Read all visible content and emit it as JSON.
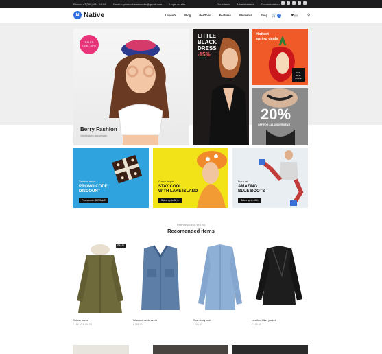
{
  "topbar": {
    "phone": "Phone: +3(266) 434-64-64",
    "email": "Email: dynamicthemeworks@gmail.com",
    "login": "Login on site",
    "links": [
      "Our clients",
      "Advertisement",
      "Documentation"
    ],
    "social_icons": [
      "facebook-icon",
      "google-plus-icon",
      "instagram-icon",
      "twitter-icon",
      "vimeo-icon"
    ]
  },
  "header": {
    "logo": "Native",
    "nav": [
      "Layouts",
      "Blog",
      "Portfolio",
      "Features",
      "Elements",
      "Shop"
    ],
    "cart_count": "0",
    "wishlist_count": "(0)"
  },
  "hero": {
    "main": {
      "sale_line1": "SALES",
      "sale_line2": "up to -50%",
      "title": "Berry Fashion",
      "subtitle": "Vestibulum accumsan"
    },
    "dress": {
      "line1": "LITTLE",
      "line2": "BLACK",
      "line3": "DRESS",
      "pct": "-15%"
    },
    "spring": {
      "line1": "Hottest",
      "line2": "spring deals",
      "tag1": "THE",
      "tag2": "BEST",
      "tag3": "PRICE"
    },
    "underwear": {
      "pct": "20%",
      "text": "OFF FOR ALL UNDERWEAR"
    }
  },
  "promos": [
    {
      "small": "Tincidunt metus",
      "big1": "PROMO CODE",
      "big2": "DISCOUNT",
      "btn": "Promocode: BIGSALE"
    },
    {
      "small": "Cursus feugiat",
      "big1": "STAY COOL",
      "big2": "WITH LAKE ISLAND",
      "btn": "Sales up to 30%"
    },
    {
      "small": "Purus vel",
      "big1": "AMAZING",
      "big2": "BLUE BOOTS",
      "btn": "Sales up to 40%"
    }
  ],
  "section": {
    "subtitle": "Pellentesque ut sed elit",
    "title": "Recomended items"
  },
  "products": [
    {
      "name": "Cotton parka",
      "price": "£ 156.00   £ 116.00",
      "sale": "SALE!"
    },
    {
      "name": "Washed denim vest",
      "price": "£ 155.00",
      "sale": ""
    },
    {
      "name": "Chambray shirt",
      "price": "£ 200.00",
      "sale": ""
    },
    {
      "name": "Leather biker jacket",
      "price": "£ 145.00",
      "sale": ""
    }
  ],
  "colors": {
    "accent": "#2f6fdc",
    "pink": "#e8357a",
    "orange": "#f05a28",
    "blue_tile": "#2ea3dd",
    "yellow_tile": "#f1e318"
  }
}
